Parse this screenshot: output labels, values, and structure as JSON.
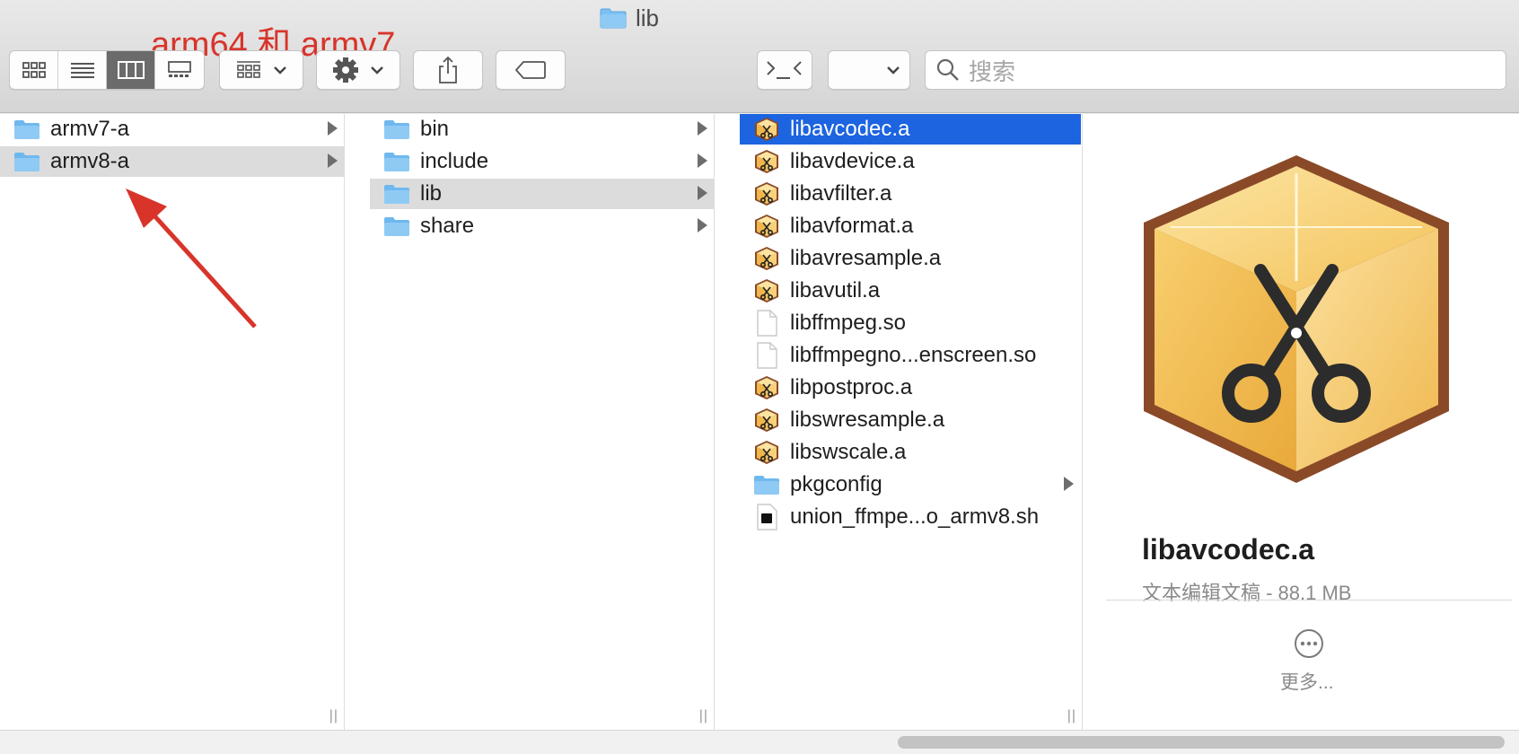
{
  "window": {
    "title": "lib"
  },
  "annotation": {
    "text": "arm64 和 armv7"
  },
  "toolbar": {
    "view_modes": [
      "icon-view-icon",
      "list-view-icon",
      "column-view-icon",
      "gallery-view-icon"
    ],
    "active_view": "column-view-icon",
    "search_placeholder": "搜索"
  },
  "columns": [
    {
      "items": [
        {
          "name": "armv7-a",
          "icon": "folder-icon",
          "has_children": true,
          "state": "none"
        },
        {
          "name": "armv8-a",
          "icon": "folder-icon",
          "has_children": true,
          "state": "inactive-selected"
        }
      ]
    },
    {
      "items": [
        {
          "name": "bin",
          "icon": "folder-icon",
          "has_children": true,
          "state": "none"
        },
        {
          "name": "include",
          "icon": "folder-icon",
          "has_children": true,
          "state": "none"
        },
        {
          "name": "lib",
          "icon": "folder-icon",
          "has_children": true,
          "state": "inactive-selected"
        },
        {
          "name": "share",
          "icon": "folder-icon",
          "has_children": true,
          "state": "none"
        }
      ]
    },
    {
      "items": [
        {
          "name": "libavcodec.a",
          "icon": "archive-icon",
          "has_children": false,
          "state": "selected"
        },
        {
          "name": "libavdevice.a",
          "icon": "archive-icon",
          "has_children": false,
          "state": "none"
        },
        {
          "name": "libavfilter.a",
          "icon": "archive-icon",
          "has_children": false,
          "state": "none"
        },
        {
          "name": "libavformat.a",
          "icon": "archive-icon",
          "has_children": false,
          "state": "none"
        },
        {
          "name": "libavresample.a",
          "icon": "archive-icon",
          "has_children": false,
          "state": "none"
        },
        {
          "name": "libavutil.a",
          "icon": "archive-icon",
          "has_children": false,
          "state": "none"
        },
        {
          "name": "libffmpeg.so",
          "icon": "document-icon",
          "has_children": false,
          "state": "none"
        },
        {
          "name": "libffmpegno...enscreen.so",
          "icon": "document-icon",
          "has_children": false,
          "state": "none"
        },
        {
          "name": "libpostproc.a",
          "icon": "archive-icon",
          "has_children": false,
          "state": "none"
        },
        {
          "name": "libswresample.a",
          "icon": "archive-icon",
          "has_children": false,
          "state": "none"
        },
        {
          "name": "libswscale.a",
          "icon": "archive-icon",
          "has_children": false,
          "state": "none"
        },
        {
          "name": "pkgconfig",
          "icon": "folder-icon",
          "has_children": true,
          "state": "none"
        },
        {
          "name": "union_ffmpe...o_armv8.sh",
          "icon": "script-icon",
          "has_children": false,
          "state": "none"
        }
      ]
    }
  ],
  "preview": {
    "icon": "archive-large-icon",
    "name": "libavcodec.a",
    "kind_size": "文本编辑文稿 - 88.1 MB",
    "more_label": "更多..."
  },
  "colors": {
    "selection": "#1c64e0",
    "annotation": "#d8342a",
    "folder": "#6fb8ef"
  }
}
